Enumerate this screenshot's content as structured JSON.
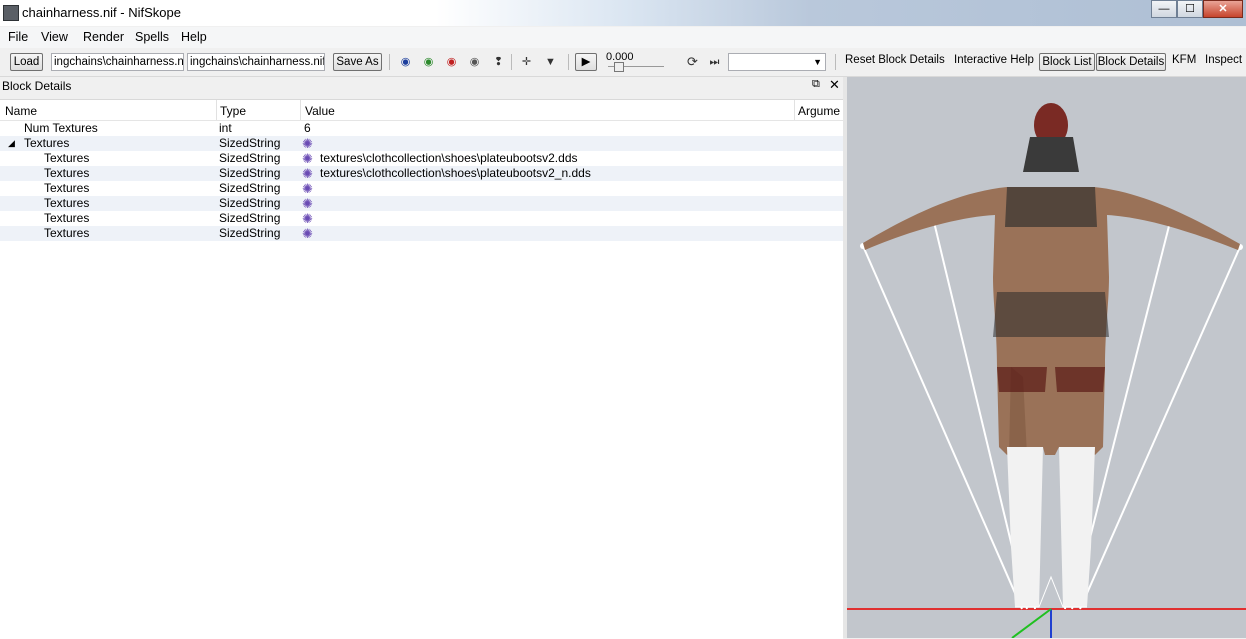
{
  "window": {
    "title": "chainharness.nif - NifSkope",
    "min_label": "—",
    "max_label": "☐",
    "close_label": "✕"
  },
  "menu": [
    "File",
    "View",
    "Render",
    "Spells",
    "Help"
  ],
  "toolbar": {
    "load_label": "Load",
    "load_path": "ingchains\\chainharness.nif",
    "save_path": "ingchains\\chainharness.nif",
    "save_as_label": "Save As",
    "time_value": "0.000",
    "reset_block_details": "Reset Block Details",
    "interactive_help": "Interactive Help",
    "block_list": "Block List",
    "block_details": "Block Details",
    "kfm": "KFM",
    "inspect": "Inspect"
  },
  "panel": {
    "title": "Block Details"
  },
  "columns": [
    "Name",
    "Type",
    "Value",
    "Argume"
  ],
  "rows": [
    {
      "name": "Num Textures",
      "type": "int",
      "value": "6",
      "indent": 1,
      "icon": false,
      "expand": false
    },
    {
      "name": "Textures",
      "type": "SizedString",
      "value": "",
      "indent": 1,
      "icon": true,
      "expand": true
    },
    {
      "name": "Textures",
      "type": "SizedString",
      "value": "textures\\clothcollection\\shoes\\plateubootsv2.dds",
      "indent": 2,
      "icon": true,
      "expand": false
    },
    {
      "name": "Textures",
      "type": "SizedString",
      "value": "textures\\clothcollection\\shoes\\plateubootsv2_n.dds",
      "indent": 2,
      "icon": true,
      "expand": false
    },
    {
      "name": "Textures",
      "type": "SizedString",
      "value": "",
      "indent": 2,
      "icon": true,
      "expand": false
    },
    {
      "name": "Textures",
      "type": "SizedString",
      "value": "",
      "indent": 2,
      "icon": true,
      "expand": false
    },
    {
      "name": "Textures",
      "type": "SizedString",
      "value": "",
      "indent": 2,
      "icon": true,
      "expand": false
    },
    {
      "name": "Textures",
      "type": "SizedString",
      "value": "",
      "indent": 2,
      "icon": true,
      "expand": false
    }
  ]
}
